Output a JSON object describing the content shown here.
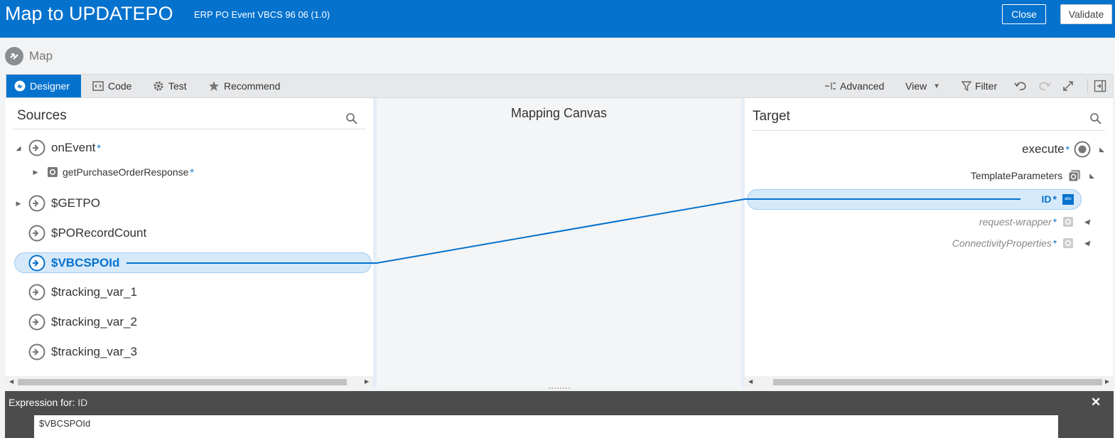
{
  "header": {
    "title": "Map to UPDATEPO",
    "subtitle": "ERP PO Event VBCS 96 06 (1.0)",
    "close_label": "Close",
    "validate_label": "Validate"
  },
  "mapbar": {
    "label": "Map"
  },
  "toolbar": {
    "tabs": [
      {
        "label": "Designer",
        "icon": "designer-icon",
        "active": true
      },
      {
        "label": "Code",
        "icon": "code-icon"
      },
      {
        "label": "Test",
        "icon": "gear-icon"
      },
      {
        "label": "Recommend",
        "icon": "star-icon"
      }
    ],
    "tools": {
      "advanced": "Advanced",
      "view": "View",
      "filter": "Filter"
    }
  },
  "sources": {
    "title": "Sources",
    "nodes": [
      {
        "label": "onEvent",
        "required": "*",
        "expanded": true
      },
      {
        "label": "getPurchaseOrderResponse",
        "required": "*"
      },
      {
        "label": "$GETPO"
      },
      {
        "label": "$PORecordCount"
      },
      {
        "label": "$VBCSPOId",
        "selected": true
      },
      {
        "label": "$tracking_var_1"
      },
      {
        "label": "$tracking_var_2"
      },
      {
        "label": "$tracking_var_3"
      }
    ]
  },
  "canvas": {
    "title": "Mapping Canvas"
  },
  "target": {
    "title": "Target",
    "nodes": [
      {
        "label": "execute",
        "required": "*"
      },
      {
        "label": "TemplateParameters"
      },
      {
        "label": "ID",
        "required": "*",
        "selected": true
      },
      {
        "label": "request-wrapper",
        "required": "*"
      },
      {
        "label": "ConnectivityProperties",
        "required": "*"
      }
    ],
    "abc_badge": "abc"
  },
  "expression": {
    "label_prefix": "Expression for:",
    "label_target": "ID",
    "value": "$VBCSPOId"
  },
  "colors": {
    "accent": "#0572ce",
    "selection": "#d6e9fa"
  }
}
